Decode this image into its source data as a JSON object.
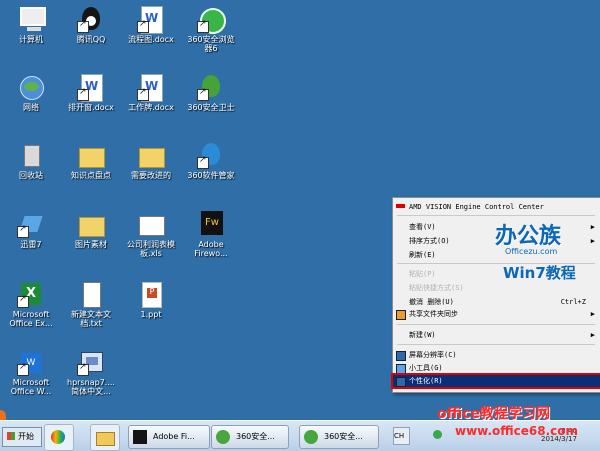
{
  "desktop": {
    "icons": [
      {
        "label": "计算机",
        "type": "computer-icon"
      },
      {
        "label": "腾讯QQ",
        "type": "qq-icon"
      },
      {
        "label": "流程图.docx",
        "type": "word-document-icon"
      },
      {
        "label": "360安全浏览\n器6",
        "type": "browser-icon"
      },
      {
        "label": "网络",
        "type": "network-icon"
      },
      {
        "label": "排开窗.docx",
        "type": "word-document-icon"
      },
      {
        "label": "工作牌.docx",
        "type": "word-document-icon"
      },
      {
        "label": "360安全卫士",
        "type": "security-icon"
      },
      {
        "label": "回收站",
        "type": "recycle-bin-icon"
      },
      {
        "label": "知识点盘点",
        "type": "folder-icon"
      },
      {
        "label": "需要改进的",
        "type": "folder-icon"
      },
      {
        "label": "360软件管家",
        "type": "software-manager-icon"
      },
      {
        "label": "迅雷7",
        "type": "thunder-icon"
      },
      {
        "label": "图片素材",
        "type": "folder-icon"
      },
      {
        "label": "公司利润表模\n板.xls",
        "type": "spreadsheet-icon"
      },
      {
        "label": "Adobe\nFirewo...",
        "type": "fireworks-icon"
      },
      {
        "label": "Microsoft\nOffice Ex...",
        "type": "excel-icon"
      },
      {
        "label": "新建文本文\n档.txt",
        "type": "text-file-icon"
      },
      {
        "label": "1.ppt",
        "type": "powerpoint-icon"
      },
      {
        "label": "Microsoft\nOffice W...",
        "type": "word-app-icon"
      },
      {
        "label": "hprsnap7....\n简体中文...",
        "type": "snapshot-icon"
      }
    ]
  },
  "context_menu": {
    "items": [
      {
        "label": "AMD VISION Engine Control Center",
        "shortcut": "",
        "disabled": false,
        "icon": "amd-icon"
      },
      {
        "label": "查看(V)",
        "shortcut": "",
        "disabled": false,
        "submenu": true
      },
      {
        "label": "排序方式(O)",
        "shortcut": "",
        "disabled": false,
        "submenu": true
      },
      {
        "label": "刷新(E)",
        "shortcut": "",
        "disabled": false
      },
      {
        "label": "粘贴(P)",
        "shortcut": "",
        "disabled": true
      },
      {
        "label": "粘贴快捷方式(S)",
        "shortcut": "",
        "disabled": true
      },
      {
        "label": "撤消 删除(U)",
        "shortcut": "Ctrl+Z",
        "disabled": false
      },
      {
        "label": "共享文件夹同步",
        "shortcut": "",
        "disabled": false,
        "icon": "sync-icon",
        "submenu": true
      },
      {
        "label": "新建(W)",
        "shortcut": "",
        "disabled": false,
        "submenu": true
      },
      {
        "label": "屏幕分辨率(C)",
        "shortcut": "",
        "disabled": false,
        "icon": "display-icon"
      },
      {
        "label": "小工具(G)",
        "shortcut": "",
        "disabled": false,
        "icon": "gadget-icon"
      },
      {
        "label": "个性化(R)",
        "shortcut": "",
        "disabled": false,
        "selected": true,
        "icon": "personalize-icon"
      }
    ]
  },
  "watermarks": {
    "office_logo": "办公族",
    "office_site": "Officezu.com",
    "win7": "Win7教程",
    "brand": "office教程学习网",
    "site": "www.office68.com"
  },
  "taskbar": {
    "start_label": "开始",
    "tasks": [
      "Adobe Fi...",
      "360安全...",
      "360安全..."
    ],
    "tray_input": "CH",
    "time": "8:40",
    "date": "2014/3/17"
  }
}
